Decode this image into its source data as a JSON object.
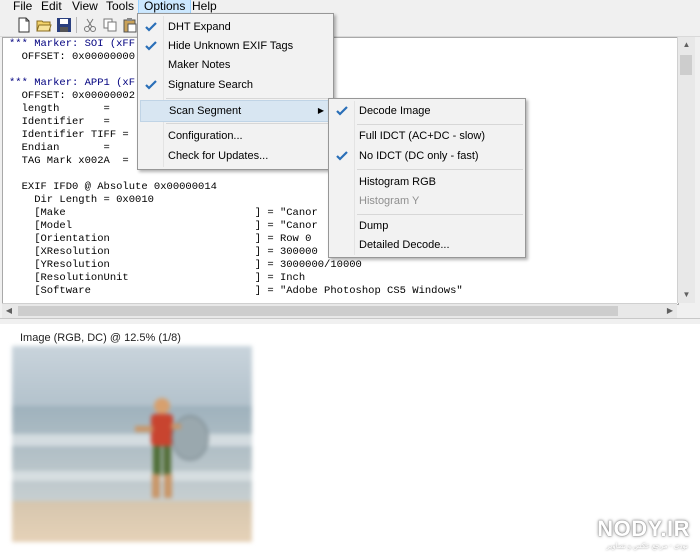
{
  "menubar": {
    "items": [
      "File",
      "Edit",
      "View",
      "Tools",
      "Options",
      "Help"
    ],
    "active": "Options"
  },
  "toolbar": {
    "icons": [
      "new-icon",
      "open-icon",
      "save-icon",
      "cut-icon",
      "copy-icon",
      "paste-icon"
    ]
  },
  "text_lines": [
    "*** Marker: SOI (xFF",
    "  OFFSET: 0x00000000",
    "",
    "*** Marker: APP1 (xF",
    "  OFFSET: 0x00000002",
    "  length       =",
    "  Identifier   =",
    "  Identifier TIFF =",
    "  Endian       =",
    "  TAG Mark x002A  =",
    "",
    "  EXIF IFD0 @ Absolute 0x00000014",
    "    Dir Length = 0x0010",
    "    [Make                              ] = \"Canor",
    "    [Model                             ] = \"Canor",
    "    [Orientation                       ] = Row 0",
    "    [XResolution                       ] = 300000",
    "    [YResolution                       ] = 3000000/10000",
    "    [ResolutionUnit                    ] = Inch",
    "    [Software                          ] = \"Adobe Photoshop CS5 Windows\""
  ],
  "options_menu": {
    "items": [
      {
        "label": "DHT Expand",
        "checked": true
      },
      {
        "label": "Hide Unknown EXIF Tags",
        "checked": true
      },
      {
        "label": "Maker Notes",
        "checked": false
      },
      {
        "label": "Signature Search",
        "checked": true
      },
      {
        "label": "Scan Segment",
        "checked": false,
        "submenu": true
      },
      {
        "label": "Configuration...",
        "checked": false
      },
      {
        "label": "Check for Updates...",
        "checked": false
      }
    ]
  },
  "scan_submenu": {
    "items": [
      {
        "label": "Decode Image",
        "checked": true
      },
      {
        "label": "Full IDCT (AC+DC - slow)",
        "checked": false
      },
      {
        "label": "No IDCT (DC only - fast)",
        "checked": true
      },
      {
        "label": "Histogram RGB",
        "checked": false
      },
      {
        "label": "Histogram Y",
        "checked": false,
        "disabled": true
      },
      {
        "label": "Dump",
        "checked": false
      },
      {
        "label": "Detailed Decode...",
        "checked": false
      }
    ]
  },
  "image_pane": {
    "caption": "Image (RGB, DC) @ 12.5% (1/8)"
  },
  "watermark": {
    "text": "NODY.IR",
    "sub": "نودی - مرجع عکس و تصاویر"
  },
  "colors": {
    "marker_text": "#00007f",
    "menu_highlight": "#d8e6f2",
    "check_blue": "#2a6fb8"
  }
}
